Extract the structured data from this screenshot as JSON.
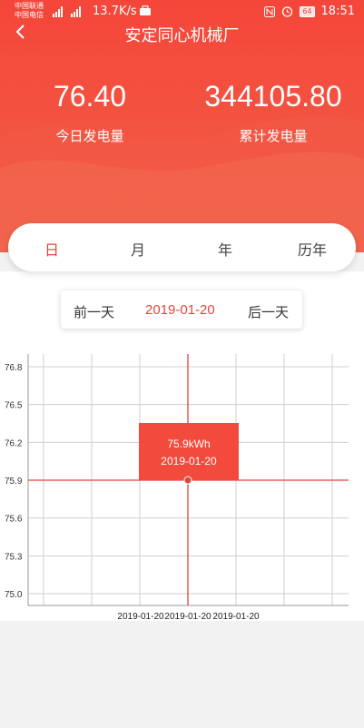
{
  "status_bar": {
    "carrier_1": "中国联通",
    "carrier_2": "中国电信",
    "net_speed": "13.7K/s",
    "battery": "64",
    "time": "18:51"
  },
  "nav": {
    "title": "安定同心机械厂"
  },
  "stats": {
    "today_value": "76.40",
    "today_label": "今日发电量",
    "total_value": "344105.80",
    "total_label": "累计发电量"
  },
  "tabs": [
    {
      "label": "日"
    },
    {
      "label": "月"
    },
    {
      "label": "年"
    },
    {
      "label": "历年"
    }
  ],
  "active_tab": "日",
  "date_bar": {
    "prev": "前一天",
    "date": "2019-01-20",
    "next": "后一天"
  },
  "colors": {
    "accent": "#e0463c",
    "header": "#f4463a"
  },
  "chart_data": {
    "type": "line",
    "yticks": [
      "76.8",
      "76.5",
      "76.2",
      "75.9",
      "75.6",
      "75.3",
      "75.0"
    ],
    "ylim": [
      75.0,
      76.8
    ],
    "xticks": [
      "2019-01-20",
      "2019-01-20",
      "2019-01-20"
    ],
    "points": [
      {
        "x": "2019-01-20",
        "y": 75.9
      }
    ],
    "highlight": {
      "value_label": "75.9kWh",
      "date_label": "2019-01-20"
    },
    "grid": true
  }
}
